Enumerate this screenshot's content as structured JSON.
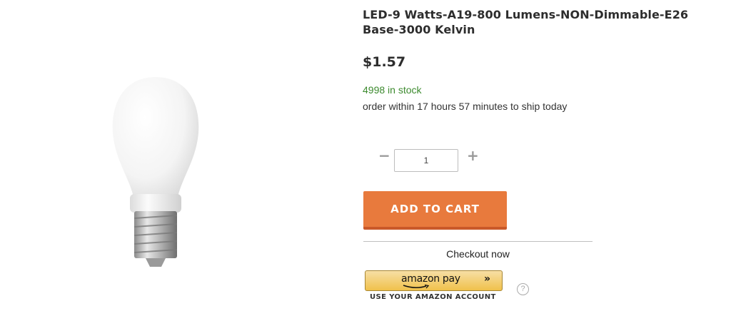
{
  "product": {
    "title": "LED-9 Watts-A19-800 Lumens-NON-Dimmable-E26 Base-3000 Kelvin",
    "price": "$1.57",
    "stock": "4998 in stock",
    "shipping": "order within 17 hours 57 minutes to ship today"
  },
  "quantity": {
    "minus": "−",
    "plus": "+",
    "value": "1"
  },
  "actions": {
    "add_to_cart": "ADD TO CART",
    "checkout_now": "Checkout now"
  },
  "amazon_pay": {
    "label": "amazon pay",
    "chevron": "»",
    "caption": "USE YOUR AMAZON ACCOUNT",
    "help": "?"
  },
  "colors": {
    "accent": "#e87a3d",
    "stock_green": "#3c8a2e"
  }
}
